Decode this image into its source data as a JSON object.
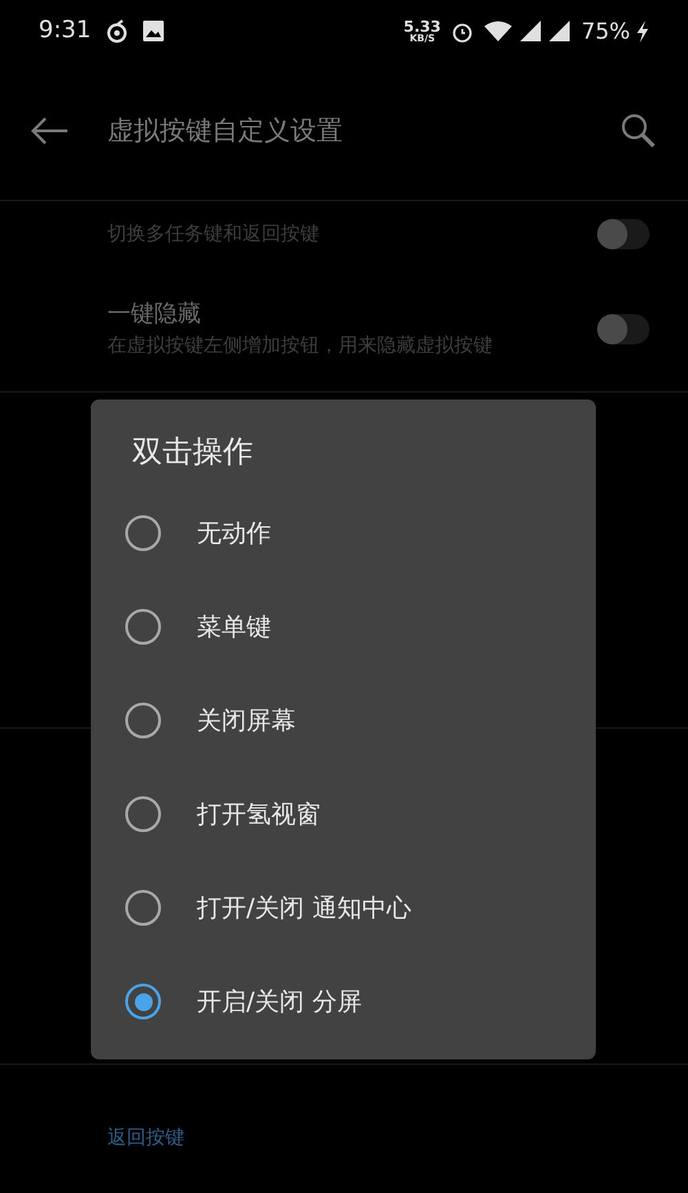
{
  "status_bar": {
    "time": "9:31",
    "speed_value": "5.33",
    "speed_unit": "KB/S",
    "battery": "75%"
  },
  "toolbar": {
    "title": "虚拟按键自定义设置"
  },
  "settings": [
    {
      "subtitle": "切换多任务键和返回按键",
      "on": false
    },
    {
      "title": "一键隐藏",
      "subtitle": "在虚拟按键左侧增加按钮，用来隐藏虚拟按键",
      "on": false
    }
  ],
  "section_header": "返回按键",
  "dialog": {
    "title": "双击操作",
    "options": [
      {
        "label": "无动作",
        "selected": false
      },
      {
        "label": "菜单键",
        "selected": false
      },
      {
        "label": "关闭屏幕",
        "selected": false
      },
      {
        "label": "打开氢视窗",
        "selected": false
      },
      {
        "label": "打开/关闭 通知中心",
        "selected": false
      },
      {
        "label": "开启/关闭 分屏",
        "selected": true
      }
    ]
  }
}
